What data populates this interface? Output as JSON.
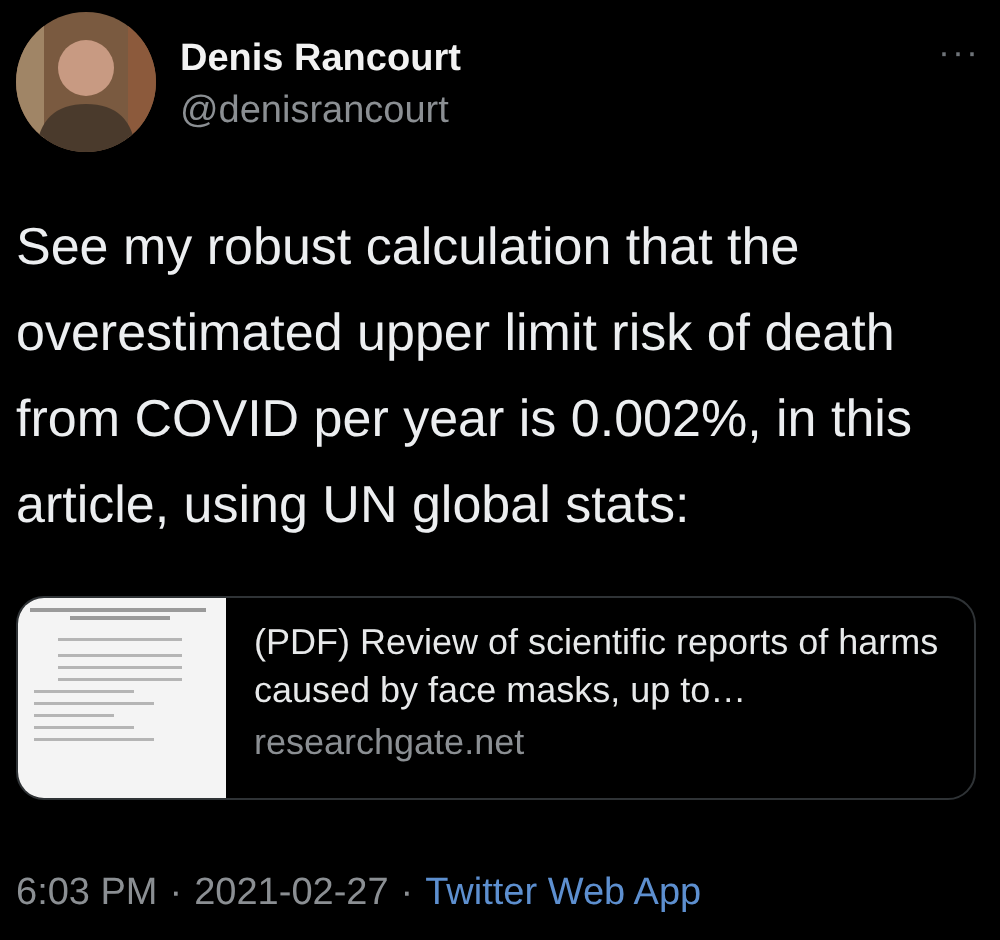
{
  "author": {
    "name": "Denis Rancourt",
    "handle": "@denisrancourt",
    "more": "···"
  },
  "text": "See my robust calculation that the overestimated upper limit risk of death from COVID per year is 0.002%, in this article, using UN global stats:",
  "link_card": {
    "title": "(PDF) Review of scientific reports of harms caused by face masks, up to…",
    "domain": "researchgate.net"
  },
  "footer": {
    "time": "6:03 PM",
    "separator_1": "·",
    "date": "2021-02-27",
    "separator_2": "·",
    "source": "Twitter Web App"
  }
}
